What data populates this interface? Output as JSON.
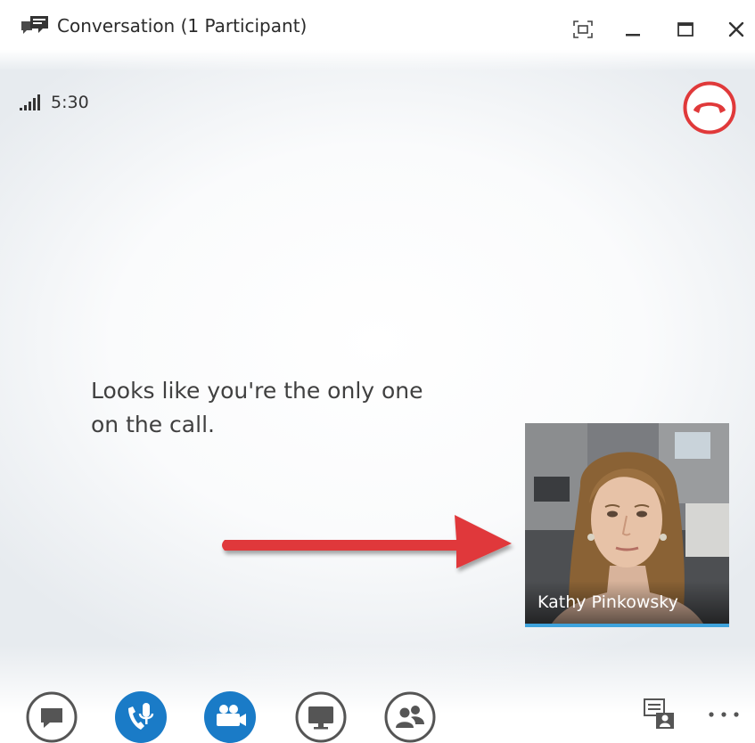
{
  "window": {
    "title": "Conversation (1 Participant)",
    "title_icon": "conversation-icon",
    "controls": {
      "fullscreen_icon": "fullscreen-icon",
      "minimize_icon": "minimize-icon",
      "maximize_icon": "maximize-icon",
      "close_icon": "close-icon"
    }
  },
  "call": {
    "signal_icon": "signal-strength-icon",
    "duration": "5:30",
    "hangup_icon": "hang-up-icon"
  },
  "stage": {
    "message": "Looks like you're the only one on the call.",
    "annotation_arrow_color": "#e0393a"
  },
  "self_video": {
    "participant_name": "Kathy Pinkowsky",
    "accent_color": "#3ea3dc"
  },
  "toolbar": {
    "buttons": [
      {
        "icon": "instant-message-icon",
        "active": false
      },
      {
        "icon": "microphone-phone-icon",
        "active": true
      },
      {
        "icon": "video-camera-icon",
        "active": true
      },
      {
        "icon": "present-screen-icon",
        "active": false
      },
      {
        "icon": "participants-icon",
        "active": false
      }
    ],
    "stage_layout_icon": "stage-layout-icon",
    "more_icon": "more-options-icon"
  },
  "colors": {
    "accent_blue": "#1a7bc7",
    "hangup_red": "#e0393a",
    "icon_gray": "#555555"
  }
}
